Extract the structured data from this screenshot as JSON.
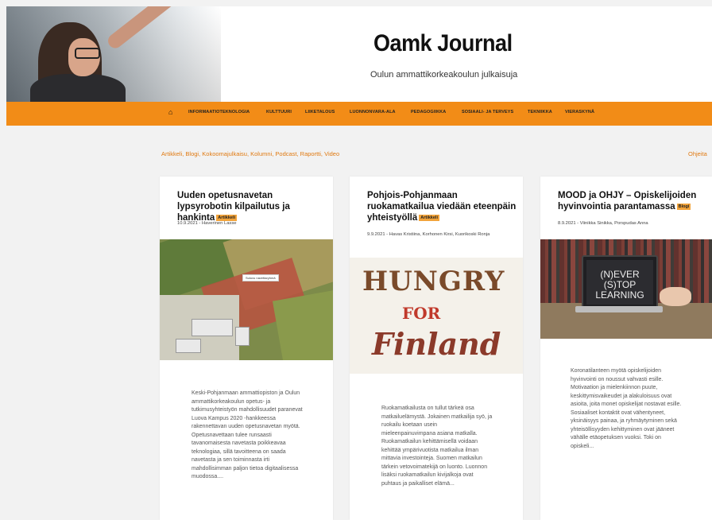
{
  "header": {
    "site_title": "Oamk Journal",
    "subtitle": "Oulun ammattikorkeakoulun julkaisuja"
  },
  "nav": {
    "home_icon": "home-icon",
    "items": [
      "INFORMAATIOTEKNOLOGIA",
      "KULTTUURI",
      "LIIKETALOUS",
      "LUONNONVARA-ALA",
      "PEDAGOGIIKKA",
      "SOSIAALI- JA TERVEYS",
      "TEKNIIKKA",
      "VIERASKYNÄ"
    ]
  },
  "categories": "Artikkeli, Blogi, Kokoomajulkaisu, Kolumni, Podcast, Raportti, Video",
  "categories_right": "Ohjeita",
  "cards": [
    {
      "title": "Uuden opetusnavetan lypsyrobotin kilpailutus ja hankinta",
      "badge": "Artikkeli",
      "meta": "10.9.2021 - Haverinen Lasse",
      "image_label": "Suluvu navettaryhmä",
      "excerpt": "Keski-Pohjanmaan ammattiopiston ja Oulun ammattikorkeakoulun opetus- ja tutkimusyhteistyön mahdollisuudet paranevat Luova Kampus 2020 -hankkeessa rakennettavan uuden opetusnavetan myötä. Opetusnavettaan tulee runsaasti tavanomaisesta navetasta poikkeavaa teknologiaa, sillä tavoitteena on saada navetasta ja sen toiminnasta irti mahdollisimman paljon tietoa digitaalisessa muodossa...."
    },
    {
      "title": "Pohjois-Pohjanmaan ruokamatkailua viedään eteenpäin yhteistyöllä",
      "badge": "Artikkeli",
      "meta": "9.9.2021 - Havas Kristiina, Korhonen Kirsi, Kuorikoski Ronja",
      "image_words": [
        "HUNGRY",
        "FOR",
        "Finland"
      ],
      "excerpt": "Ruokamatkailusta on tullut tärkeä osa matkailuelämystä. Jokainen matkailija syö, ja ruokailu koetaan usein mieleenpainuvimpana asiana matkalla. Ruokamatkailun kehittämisellä voidaan kehittää ympärivuotista matkailua ilman mittavia investointeja. Suomen matkailun tärkein vetovoimatekijä on luonto. Luonnon lisäksi ruokamatkailun kivijalkoja ovat puhtaus ja paikalliset elämä..."
    },
    {
      "title": "MOOD ja OHJY – Opiskelijoiden hyvinvointia parantamassa",
      "badge": "Blogi",
      "meta": "8.9.2021 - Viinikka Sinikka, Porspudas Anna",
      "image_text": "(N)EVER (S)TOP LEARNING",
      "excerpt": "Koronatilanteen myötä opiskelijoiden hyvinvointi on noussut vahvasti esille. Motivaation ja mielenkiinnon puute, keskittymisvaikeudet ja alakuloisuus ovat asioita, joita monet opiskelijat nostavat esille. Sosiaaliset kontaktit ovat vähentyneet, yksinäisyys painaa, ja ryhmäytyminen sekä yhteisöllisyyden kehittyminen ovat jääneet vähälle etäopetuksen vuoksi. Toki on opiskeli..."
    }
  ]
}
